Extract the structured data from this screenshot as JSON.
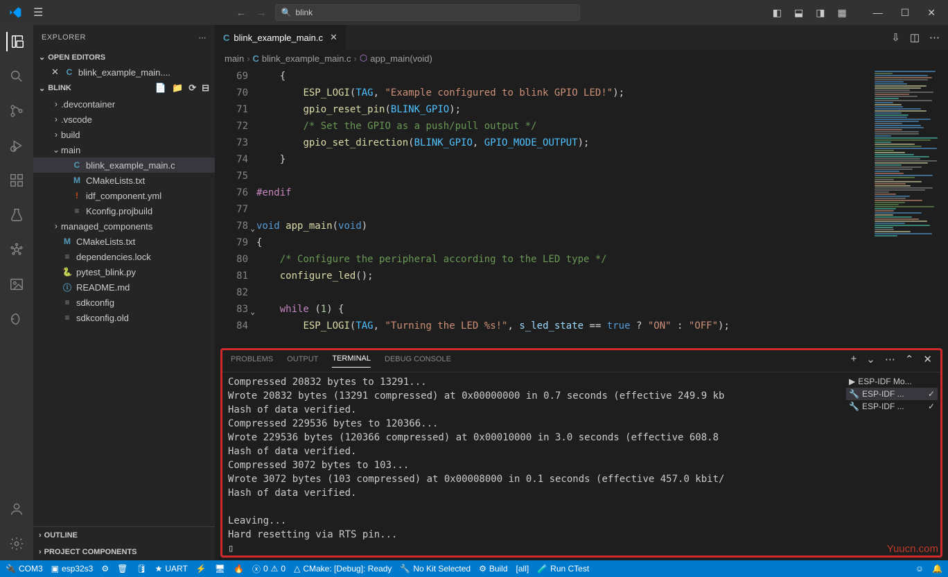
{
  "titlebar": {
    "search": "blink"
  },
  "sidebar": {
    "title": "EXPLORER",
    "open_editors": "OPEN EDITORS",
    "project": "BLINK",
    "open_file": "blink_example_main....",
    "tree": [
      {
        "name": ".devcontainer",
        "type": "folder",
        "indent": 1
      },
      {
        "name": ".vscode",
        "type": "folder",
        "indent": 1
      },
      {
        "name": "build",
        "type": "folder",
        "indent": 1
      },
      {
        "name": "main",
        "type": "folder-open",
        "indent": 1
      },
      {
        "name": "blink_example_main.c",
        "type": "c",
        "indent": 2,
        "sel": true
      },
      {
        "name": "CMakeLists.txt",
        "type": "m",
        "indent": 2
      },
      {
        "name": "idf_component.yml",
        "type": "yml",
        "indent": 2
      },
      {
        "name": "Kconfig.projbuild",
        "type": "conf",
        "indent": 2
      },
      {
        "name": "managed_components",
        "type": "folder",
        "indent": 1
      },
      {
        "name": "CMakeLists.txt",
        "type": "m",
        "indent": 1
      },
      {
        "name": "dependencies.lock",
        "type": "lock",
        "indent": 1
      },
      {
        "name": "pytest_blink.py",
        "type": "py",
        "indent": 1
      },
      {
        "name": "README.md",
        "type": "info",
        "indent": 1
      },
      {
        "name": "sdkconfig",
        "type": "conf",
        "indent": 1
      },
      {
        "name": "sdkconfig.old",
        "type": "conf",
        "indent": 1
      }
    ],
    "outline": "OUTLINE",
    "proj_comp": "PROJECT COMPONENTS"
  },
  "tab": {
    "file": "blink_example_main.c"
  },
  "breadcrumb": {
    "a": "main",
    "b": "blink_example_main.c",
    "c": "app_main(void)"
  },
  "code": {
    "start": 69,
    "lines": [
      {
        "n": 69,
        "html": "    <span class='tk-punc'>{</span>"
      },
      {
        "n": 70,
        "html": "        <span class='tk-func'>ESP_LOGI</span><span class='tk-punc'>(</span><span class='tk-const'>TAG</span><span class='tk-punc'>,</span> <span class='tk-str'>\"Example configured to blink GPIO LED!\"</span><span class='tk-punc'>);</span>"
      },
      {
        "n": 71,
        "html": "        <span class='tk-func'>gpio_reset_pin</span><span class='tk-punc'>(</span><span class='tk-const'>BLINK_GPIO</span><span class='tk-punc'>);</span>"
      },
      {
        "n": 72,
        "html": "        <span class='tk-comment'>/* Set the GPIO as a push/pull output */</span>"
      },
      {
        "n": 73,
        "html": "        <span class='tk-func'>gpio_set_direction</span><span class='tk-punc'>(</span><span class='tk-const'>BLINK_GPIO</span><span class='tk-punc'>,</span> <span class='tk-const'>GPIO_MODE_OUTPUT</span><span class='tk-punc'>);</span>"
      },
      {
        "n": 74,
        "html": "    <span class='tk-punc'>}</span>"
      },
      {
        "n": 75,
        "html": ""
      },
      {
        "n": 76,
        "html": "<span class='tk-keyword2'>#endif</span>"
      },
      {
        "n": 77,
        "html": ""
      },
      {
        "n": 78,
        "html": "<span class='tk-keyword'>void</span> <span class='tk-func'>app_main</span><span class='tk-punc'>(</span><span class='tk-keyword'>void</span><span class='tk-punc'>)</span>",
        "fold": true
      },
      {
        "n": 79,
        "html": "<span class='tk-punc'>{</span>"
      },
      {
        "n": 80,
        "html": "    <span class='tk-comment'>/* Configure the peripheral according to the LED type */</span>"
      },
      {
        "n": 81,
        "html": "    <span class='tk-func'>configure_led</span><span class='tk-punc'>();</span>"
      },
      {
        "n": 82,
        "html": ""
      },
      {
        "n": 83,
        "html": "    <span class='tk-keyword2'>while</span> <span class='tk-punc'>(</span><span class='tk-num'>1</span><span class='tk-punc'>) {</span>",
        "fold": true
      },
      {
        "n": 84,
        "html": "        <span class='tk-func'>ESP_LOGI</span><span class='tk-punc'>(</span><span class='tk-const'>TAG</span><span class='tk-punc'>,</span> <span class='tk-str'>\"Turning the LED %s!\"</span><span class='tk-punc'>,</span> <span class='tk-param'>s_led_state</span> <span class='tk-punc'>==</span> <span class='tk-keyword'>true</span> <span class='tk-punc'>?</span> <span class='tk-str'>\"ON\"</span> <span class='tk-punc'>:</span> <span class='tk-str'>\"OFF\"</span><span class='tk-punc'>);</span>"
      }
    ]
  },
  "panel": {
    "tabs": {
      "problems": "PROBLEMS",
      "output": "OUTPUT",
      "terminal": "TERMINAL",
      "debug": "DEBUG CONSOLE"
    },
    "terminal": "Compressed 20832 bytes to 13291...\nWrote 20832 bytes (13291 compressed) at 0x00000000 in 0.7 seconds (effective 249.9 kb\nHash of data verified.\nCompressed 229536 bytes to 120366...\nWrote 229536 bytes (120366 compressed) at 0x00010000 in 3.0 seconds (effective 608.8\nHash of data verified.\nCompressed 3072 bytes to 103...\nWrote 3072 bytes (103 compressed) at 0x00008000 in 0.1 seconds (effective 457.0 kbit/\nHash of data verified.\n\nLeaving...\nHard resetting via RTS pin...\n▯",
    "term_list": [
      {
        "label": "ESP-IDF Mo...",
        "icon": "▶"
      },
      {
        "label": "ESP-IDF ...",
        "icon": "🔧",
        "check": true,
        "sel": true
      },
      {
        "label": "ESP-IDF ...",
        "icon": "🔧",
        "check": true
      }
    ]
  },
  "status": {
    "port": "COM3",
    "target": "esp32s3",
    "uart": "UART",
    "cmake": "CMake: [Debug]: Ready",
    "kit": "No Kit Selected",
    "build": "Build",
    "all": "[all]",
    "ctest": "Run CTest",
    "errors": "0",
    "warnings": "0"
  },
  "watermark": "Yuucn.com"
}
